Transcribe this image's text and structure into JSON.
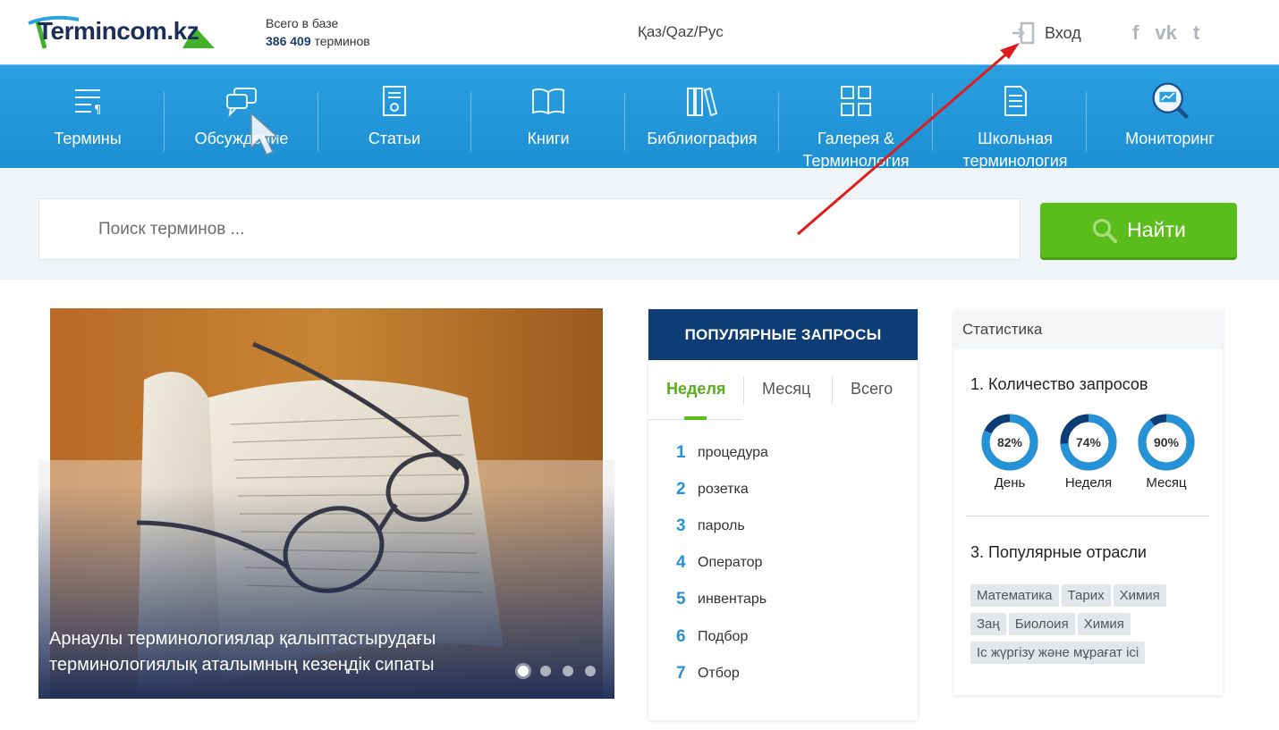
{
  "header": {
    "logo_text": "Termincom.kz",
    "base_label": "Всего в базе",
    "base_count": "386 409",
    "base_unit": "терминов",
    "lang_switch": "Қаз/Qaz/Рус",
    "login_label": "Вход",
    "social": [
      {
        "name": "facebook",
        "glyph": "f"
      },
      {
        "name": "vkontakte",
        "glyph": "vk"
      },
      {
        "name": "twitter",
        "glyph": "t"
      }
    ]
  },
  "nav": {
    "items": [
      {
        "label": "Термины",
        "icon": "list-icon"
      },
      {
        "label": "Обсуждение",
        "icon": "chat-icon"
      },
      {
        "label": "Статьи",
        "icon": "article-icon"
      },
      {
        "label": "Книги",
        "icon": "book-icon"
      },
      {
        "label": "Библиография",
        "icon": "library-icon"
      },
      {
        "label": "Галерея & Терминология",
        "icon": "gallery-icon"
      },
      {
        "label": "Школьная терминология",
        "icon": "document-icon"
      },
      {
        "label": "Мониторинг",
        "icon": "monitoring-icon"
      }
    ]
  },
  "search": {
    "placeholder": "Поиск терминов ...",
    "button_label": "Найти"
  },
  "slider": {
    "caption": "Арнаулы терминологиялар қалыптастырудағы терминологиялық аталымның кезеңдік сипаты",
    "slide_count": 4,
    "active_slide": 1
  },
  "popular": {
    "title": "ПОПУЛЯРНЫЕ ЗАПРОСЫ",
    "tabs": [
      "Неделя",
      "Месяц",
      "Всего"
    ],
    "active_tab": "Неделя",
    "items": [
      {
        "num": "1",
        "text": "процедура"
      },
      {
        "num": "2",
        "text": "розетка"
      },
      {
        "num": "3",
        "text": "пароль"
      },
      {
        "num": "4",
        "text": "Оператор"
      },
      {
        "num": "5",
        "text": "инвентарь"
      },
      {
        "num": "6",
        "text": "Подбор"
      },
      {
        "num": "7",
        "text": "Отбор"
      }
    ]
  },
  "stats": {
    "title": "Статистика",
    "requests_heading": "1. Количество запросов",
    "donuts": [
      {
        "pct": "82%",
        "value": 82,
        "label": "День"
      },
      {
        "pct": "74%",
        "value": 74,
        "label": "Неделя"
      },
      {
        "pct": "90%",
        "value": 90,
        "label": "Месяц"
      }
    ],
    "industries_heading": "3. Популярные отрасли",
    "tags": [
      "Математика",
      "Тарих",
      "Химия",
      "Заң",
      "Биолоия",
      "Химия",
      "Іс жүргізу және мұрағат ісі"
    ]
  },
  "colors": {
    "nav_blue": "#1d8fd4",
    "dark_blue": "#0e3d76",
    "green": "#5bbd1b",
    "accent_blue": "#2592d8",
    "arrow_red": "#e01b1b"
  }
}
